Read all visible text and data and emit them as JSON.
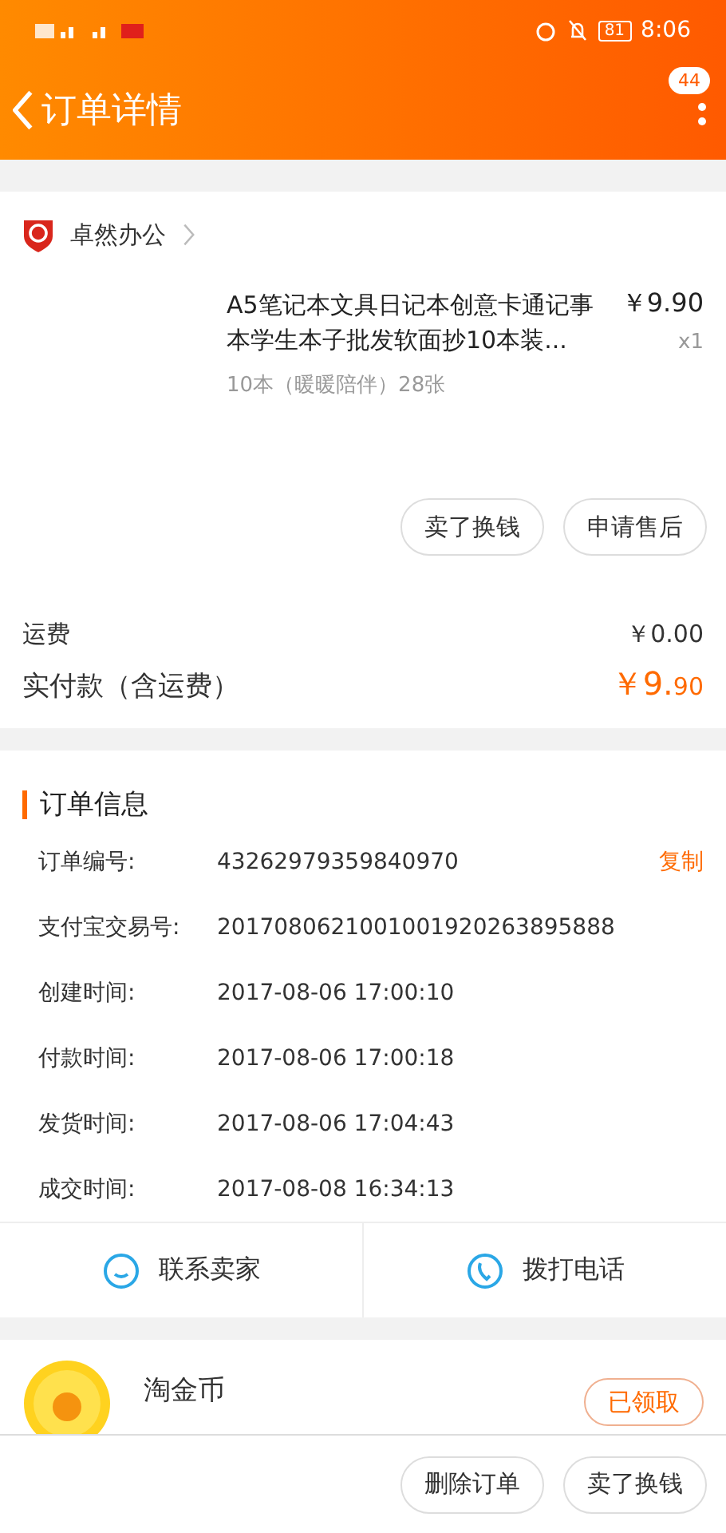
{
  "status_bar": {
    "battery": "81",
    "time": "8:06"
  },
  "header": {
    "title": "订单详情",
    "badge": "44"
  },
  "order_item": {
    "shop_name": "卓然办公",
    "title": "A5笔记本文具日记本创意卡通记事本学生本子批发软面抄10本装...",
    "price": "￥9.90",
    "quantity": "x1",
    "sku": "10本（暖暖陪伴）28张",
    "actions": [
      "卖了换钱",
      "申请售后"
    ]
  },
  "costs": [
    {
      "label": "运费",
      "value": "￥0.00",
      "kind": "plain"
    },
    {
      "label": "实付款（含运费）",
      "value": "￥9.",
      "value_small": "90",
      "kind": "total"
    }
  ],
  "order_info": {
    "title": "订单信息",
    "rows": [
      {
        "label": "订单编号:",
        "value": "43262979359840970",
        "action": "复制"
      },
      {
        "label": "支付宝交易号:",
        "value": "2017080621001001920263895888"
      },
      {
        "label": "创建时间:",
        "value": "2017-08-06 17:00:10"
      },
      {
        "label": "付款时间:",
        "value": "2017-08-06 17:00:18"
      },
      {
        "label": "发货时间:",
        "value": "2017-08-06 17:04:43"
      },
      {
        "label": "成交时间:",
        "value": "2017-08-08 16:34:13"
      }
    ]
  },
  "contacts": [
    {
      "label": "联系卖家",
      "kind": "chat"
    },
    {
      "label": "拨打电话",
      "kind": "phone"
    }
  ],
  "coin": {
    "title": "淘金币",
    "button": "已领取"
  },
  "bottom_actions": [
    "删除订单",
    "卖了换钱"
  ]
}
